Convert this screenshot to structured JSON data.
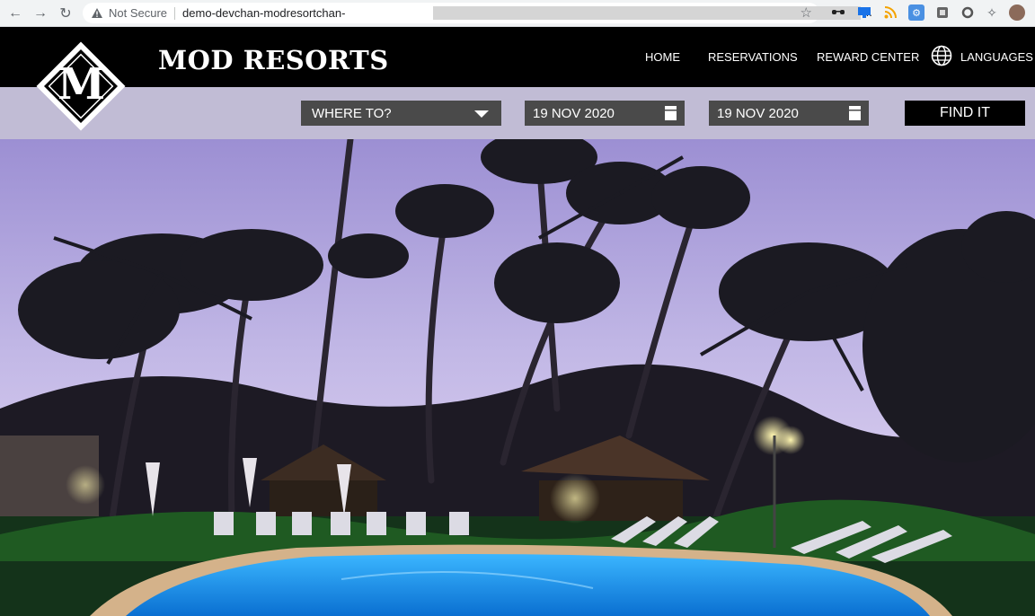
{
  "browser": {
    "security_label": "Not Secure",
    "url_prefix": "demo-devchan-modresortchan-",
    "url_truncated": "..."
  },
  "site": {
    "brand": "MOD RESORTS",
    "logo_letter": "M",
    "nav": {
      "home": "HOME",
      "reservations": "RESERVATIONS",
      "reward_center": "REWARD CENTER",
      "languages": "LANGUAGES"
    }
  },
  "search": {
    "destination": "WHERE TO?",
    "checkin": "19 NOV 2020",
    "checkout": "19 NOV 2020",
    "find_label": "FIND IT"
  },
  "colors": {
    "header_bg": "#000000",
    "searchbar_bg": "#d6d0ec",
    "field_bg": "#4a4a4a",
    "sky_top": "#9a8bd0",
    "pool": "#2aa7ff"
  }
}
